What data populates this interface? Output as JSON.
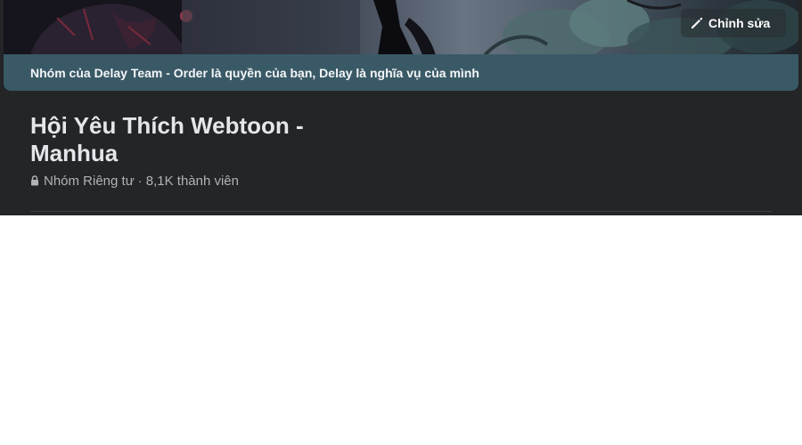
{
  "cover": {
    "banner_text": "Nhóm của Delay Team - Order là quyền của bạn, Delay là nghĩa vụ của mình",
    "edit_button_label": "Chỉnh sửa",
    "edit_icon": "pencil-icon"
  },
  "group": {
    "title": "Hội Yêu Thích Webtoon - Manhua",
    "privacy_icon": "lock-icon",
    "privacy": "Nhóm Riêng tư",
    "separator": "·",
    "members": "8,1K thành viên"
  },
  "colors": {
    "background": "#242526",
    "banner": "#3a5966",
    "title_text": "#e4e6eb",
    "secondary_text": "#b0b3b8"
  }
}
